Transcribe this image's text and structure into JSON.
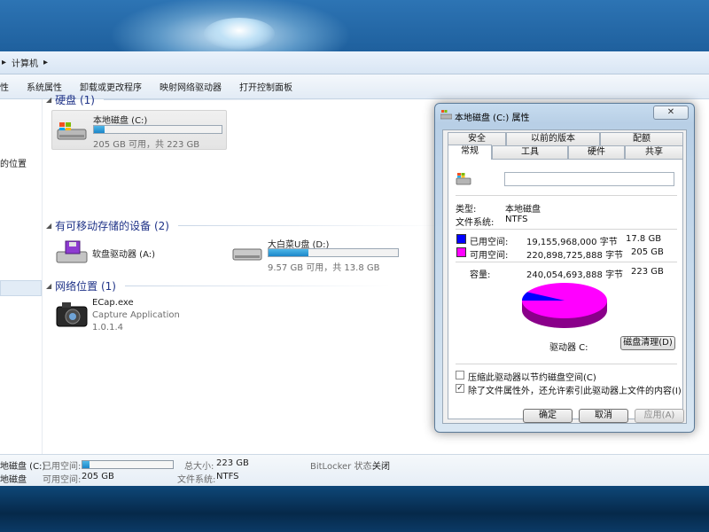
{
  "address": {
    "separator": "▸",
    "path": "计算机"
  },
  "toolbar": {
    "items": [
      "性",
      "系统属性",
      "卸载或更改程序",
      "映射网络驱动器",
      "打开控制面板"
    ]
  },
  "nav": {
    "item": "的位置"
  },
  "groups": {
    "hdd": {
      "label": "硬盘 (1)"
    },
    "removable": {
      "label": "有可移动存储的设备 (2)"
    },
    "network": {
      "label": "网络位置 (1)"
    }
  },
  "drives": {
    "c": {
      "name": "本地磁盘 (C:)",
      "free_text": "205 GB 可用，共 223 GB",
      "used_fraction": 0.08
    },
    "a": {
      "name": "软盘驱动器 (A:)"
    },
    "d": {
      "name": "大白菜U盘 (D:)",
      "free_text": "9.57 GB 可用，共 13.8 GB",
      "used_fraction": 0.31
    },
    "ecap": {
      "name": "ECap.exe",
      "desc": "Capture Application",
      "version": "1.0.1.4"
    }
  },
  "details": {
    "drive": "地磁盘 (C:)",
    "drive2": "地磁盘",
    "used_label": "已用空间:",
    "free_label": "可用空间:",
    "free_value": "205 GB",
    "total_label": "总大小:",
    "total_value": "223 GB",
    "fs_label": "文件系统:",
    "fs_value": "NTFS",
    "bitlocker_label": "BitLocker 状态:",
    "bitlocker_value": "关闭",
    "used_fraction": 0.08
  },
  "dialog": {
    "title": "本地磁盘 (C:) 属性",
    "close": "✕",
    "tabs_top": [
      "安全",
      "以前的版本",
      "配额"
    ],
    "tabs_bottom": [
      "常规",
      "工具",
      "硬件",
      "共享"
    ],
    "type_label": "类型:",
    "type_value": "本地磁盘",
    "fs_label": "文件系统:",
    "fs_value": "NTFS",
    "used_label": "已用空间:",
    "used_bytes": "19,155,968,000 字节",
    "used_gb": "17.8 GB",
    "free_label": "可用空间:",
    "free_bytes": "220,898,725,888 字节",
    "free_gb": "205 GB",
    "cap_label": "容量:",
    "cap_bytes": "240,054,693,888 字节",
    "cap_gb": "223 GB",
    "drive_label": "驱动器 C:",
    "cleanup_button": "磁盘清理(D)",
    "compress_label": "压缩此驱动器以节约磁盘空间(C)",
    "index_label": "除了文件属性外，还允许索引此驱动器上文件的内容(I)",
    "ok_button": "确定",
    "cancel_button": "取消",
    "apply_button": "应用(A)",
    "used_color": "#0000ff",
    "free_color": "#ff00ff"
  }
}
